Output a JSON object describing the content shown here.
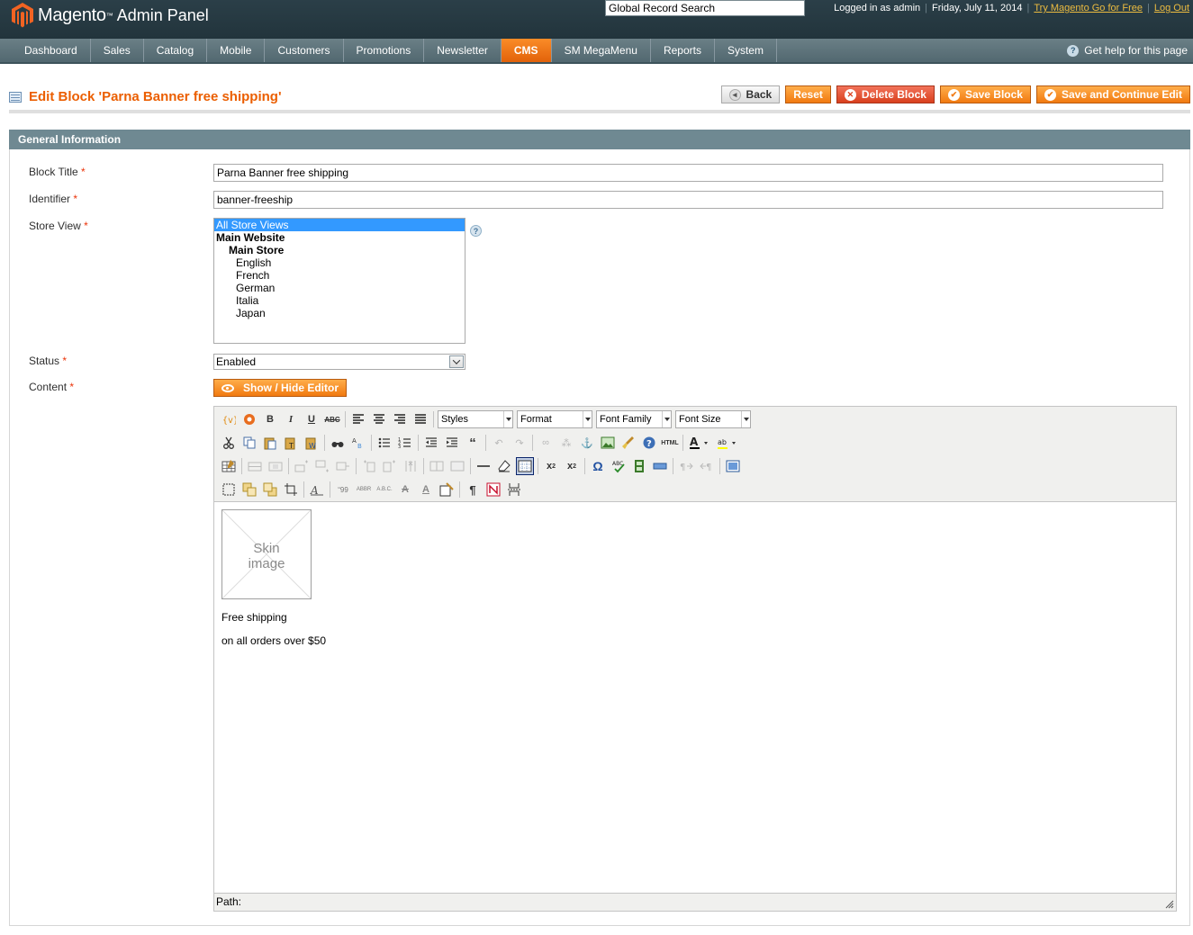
{
  "header": {
    "brand": "Magento",
    "brand_tm": "™",
    "brand_sub": "Admin Panel",
    "search_value": "Global Record Search",
    "logged_in": "Logged in as admin",
    "date": "Friday, July 11, 2014",
    "try_link": "Try Magento Go for Free",
    "logout": "Log Out",
    "separator": "|"
  },
  "nav": {
    "items": [
      {
        "label": "Dashboard"
      },
      {
        "label": "Sales"
      },
      {
        "label": "Catalog"
      },
      {
        "label": "Mobile"
      },
      {
        "label": "Customers"
      },
      {
        "label": "Promotions"
      },
      {
        "label": "Newsletter"
      },
      {
        "label": "CMS",
        "active": true
      },
      {
        "label": "SM MegaMenu"
      },
      {
        "label": "Reports"
      },
      {
        "label": "System"
      }
    ],
    "help": "Get help for this page"
  },
  "page": {
    "title": "Edit Block 'Parna Banner free shipping'",
    "buttons": {
      "back": "Back",
      "reset": "Reset",
      "delete": "Delete Block",
      "save": "Save Block",
      "save_continue": "Save and Continue Edit"
    }
  },
  "form": {
    "section_title": "General Information",
    "required_mark": "*",
    "block_title_label": "Block Title",
    "block_title_value": "Parna Banner free shipping",
    "identifier_label": "Identifier",
    "identifier_value": "banner-freeship",
    "store_view_label": "Store View",
    "store_views": [
      {
        "label": "All Store Views",
        "selected": true,
        "level": 0,
        "bold": false
      },
      {
        "label": "Main Website",
        "selected": false,
        "level": 0,
        "bold": true
      },
      {
        "label": "Main Store",
        "selected": false,
        "level": 1,
        "bold": true
      },
      {
        "label": "English",
        "selected": false,
        "level": 2,
        "bold": false
      },
      {
        "label": "French",
        "selected": false,
        "level": 2,
        "bold": false
      },
      {
        "label": "German",
        "selected": false,
        "level": 2,
        "bold": false
      },
      {
        "label": "Italia",
        "selected": false,
        "level": 2,
        "bold": false
      },
      {
        "label": "Japan",
        "selected": false,
        "level": 2,
        "bold": false
      }
    ],
    "status_label": "Status",
    "status_value": "Enabled",
    "content_label": "Content",
    "show_hide_label": "Show / Hide Editor"
  },
  "editor": {
    "dropdowns": {
      "styles": "Styles",
      "format": "Format",
      "font_family": "Font Family",
      "font_size": "Font Size"
    },
    "content": {
      "image_placeholder_line1": "Skin",
      "image_placeholder_line2": "image",
      "paragraph1": "Free shipping",
      "paragraph2": "on all orders over $50"
    },
    "path_label": "Path:"
  }
}
